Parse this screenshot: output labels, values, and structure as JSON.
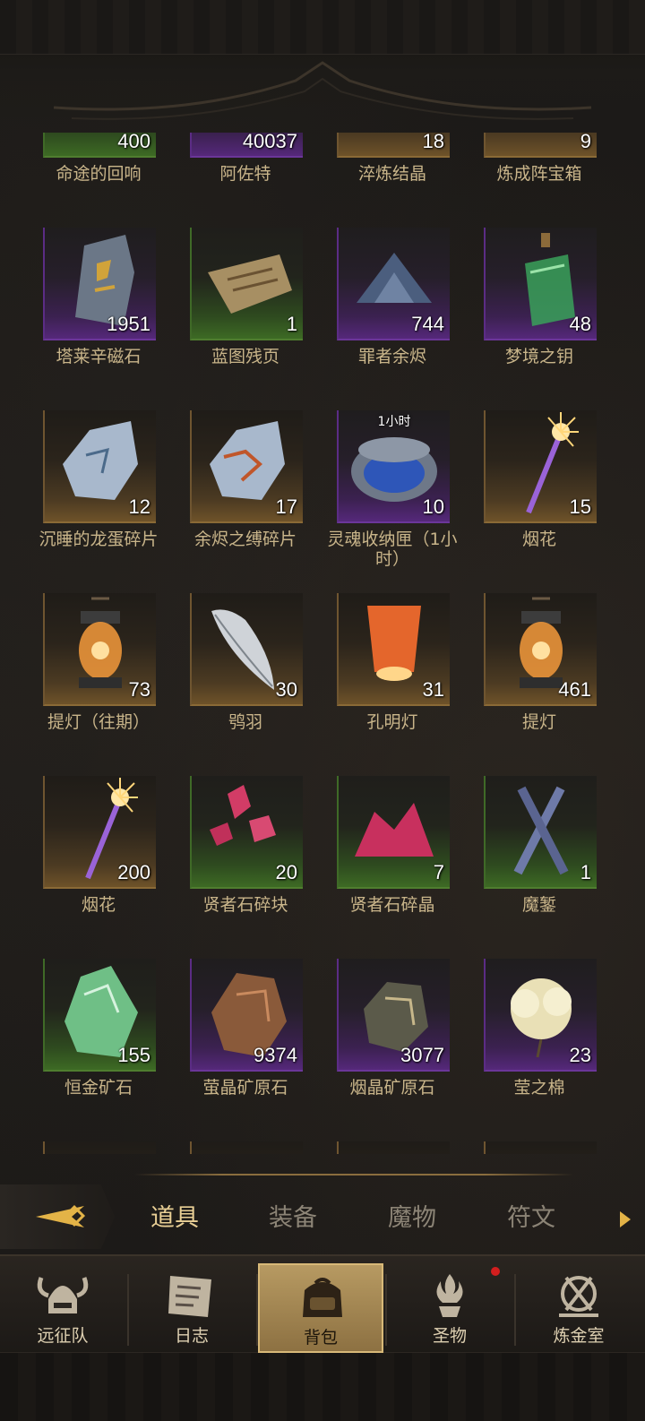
{
  "inventory": {
    "items": [
      {
        "name": "命途的回响",
        "qty": "400",
        "rarity": "green",
        "icon": "echo-icon"
      },
      {
        "name": "阿佐特",
        "qty": "40037",
        "rarity": "purple",
        "icon": "azoth-icon"
      },
      {
        "name": "淬炼结晶",
        "qty": "18",
        "rarity": "gold",
        "icon": "crystal-icon"
      },
      {
        "name": "炼成阵宝箱",
        "qty": "9",
        "rarity": "gold",
        "icon": "chest-icon"
      },
      {
        "name": "塔莱辛磁石",
        "qty": "1951",
        "rarity": "purple",
        "icon": "rune-stone-icon"
      },
      {
        "name": "蓝图残页",
        "qty": "1",
        "rarity": "green",
        "icon": "blueprint-icon"
      },
      {
        "name": "罪者余烬",
        "qty": "744",
        "rarity": "purple",
        "icon": "ember-pile-icon"
      },
      {
        "name": "梦境之钥",
        "qty": "48",
        "rarity": "purple",
        "icon": "potion-icon"
      },
      {
        "name": "沉睡的龙蛋碎片",
        "qty": "12",
        "rarity": "gold",
        "icon": "dragon-egg-shard-icon"
      },
      {
        "name": "余烬之缚碎片",
        "qty": "17",
        "rarity": "gold",
        "icon": "ember-shard-icon"
      },
      {
        "name": "灵魂收纳匣（1小时）",
        "qty": "10",
        "rarity": "purple",
        "icon": "soul-box-icon",
        "timer": "1小时"
      },
      {
        "name": "烟花",
        "qty": "15",
        "rarity": "gold",
        "icon": "firework-icon"
      },
      {
        "name": "提灯（往期）",
        "qty": "73",
        "rarity": "gold",
        "icon": "lantern-icon"
      },
      {
        "name": "鸮羽",
        "qty": "30",
        "rarity": "gold",
        "icon": "feather-icon"
      },
      {
        "name": "孔明灯",
        "qty": "31",
        "rarity": "gold",
        "icon": "sky-lantern-icon"
      },
      {
        "name": "提灯",
        "qty": "461",
        "rarity": "gold",
        "icon": "lantern-icon"
      },
      {
        "name": "烟花",
        "qty": "200",
        "rarity": "gold",
        "icon": "firework-icon"
      },
      {
        "name": "贤者石碎块",
        "qty": "20",
        "rarity": "green",
        "icon": "red-gem-icon"
      },
      {
        "name": "贤者石碎晶",
        "qty": "7",
        "rarity": "green",
        "icon": "red-crystal-icon"
      },
      {
        "name": "魔錾",
        "qty": "1",
        "rarity": "green",
        "icon": "chisel-icon"
      },
      {
        "name": "恒金矿石",
        "qty": "155",
        "rarity": "green",
        "icon": "green-ore-icon"
      },
      {
        "name": "萤晶矿原石",
        "qty": "9374",
        "rarity": "purple",
        "icon": "amber-ore-icon"
      },
      {
        "name": "烟晶矿原石",
        "qty": "3077",
        "rarity": "purple",
        "icon": "smoky-ore-icon"
      },
      {
        "name": "莹之棉",
        "qty": "23",
        "rarity": "purple",
        "icon": "cotton-icon"
      }
    ]
  },
  "tabs": [
    {
      "label": "道具",
      "active": true
    },
    {
      "label": "装备",
      "active": false
    },
    {
      "label": "魔物",
      "active": false
    },
    {
      "label": "符文",
      "active": false
    }
  ],
  "nav": [
    {
      "label": "远征队",
      "icon": "viking-helmet-icon",
      "active": false,
      "badge": false
    },
    {
      "label": "日志",
      "icon": "journal-icon",
      "active": false,
      "badge": false
    },
    {
      "label": "背包",
      "icon": "backpack-icon",
      "active": true,
      "badge": false
    },
    {
      "label": "圣物",
      "icon": "relic-icon",
      "active": false,
      "badge": true
    },
    {
      "label": "炼金室",
      "icon": "alchemy-icon",
      "active": false,
      "badge": false
    }
  ],
  "colors": {
    "green": "#3d6a24",
    "purple": "#55287a",
    "gold": "#6e5229",
    "accent": "#e9cf95",
    "badge": "#d21e1e"
  }
}
